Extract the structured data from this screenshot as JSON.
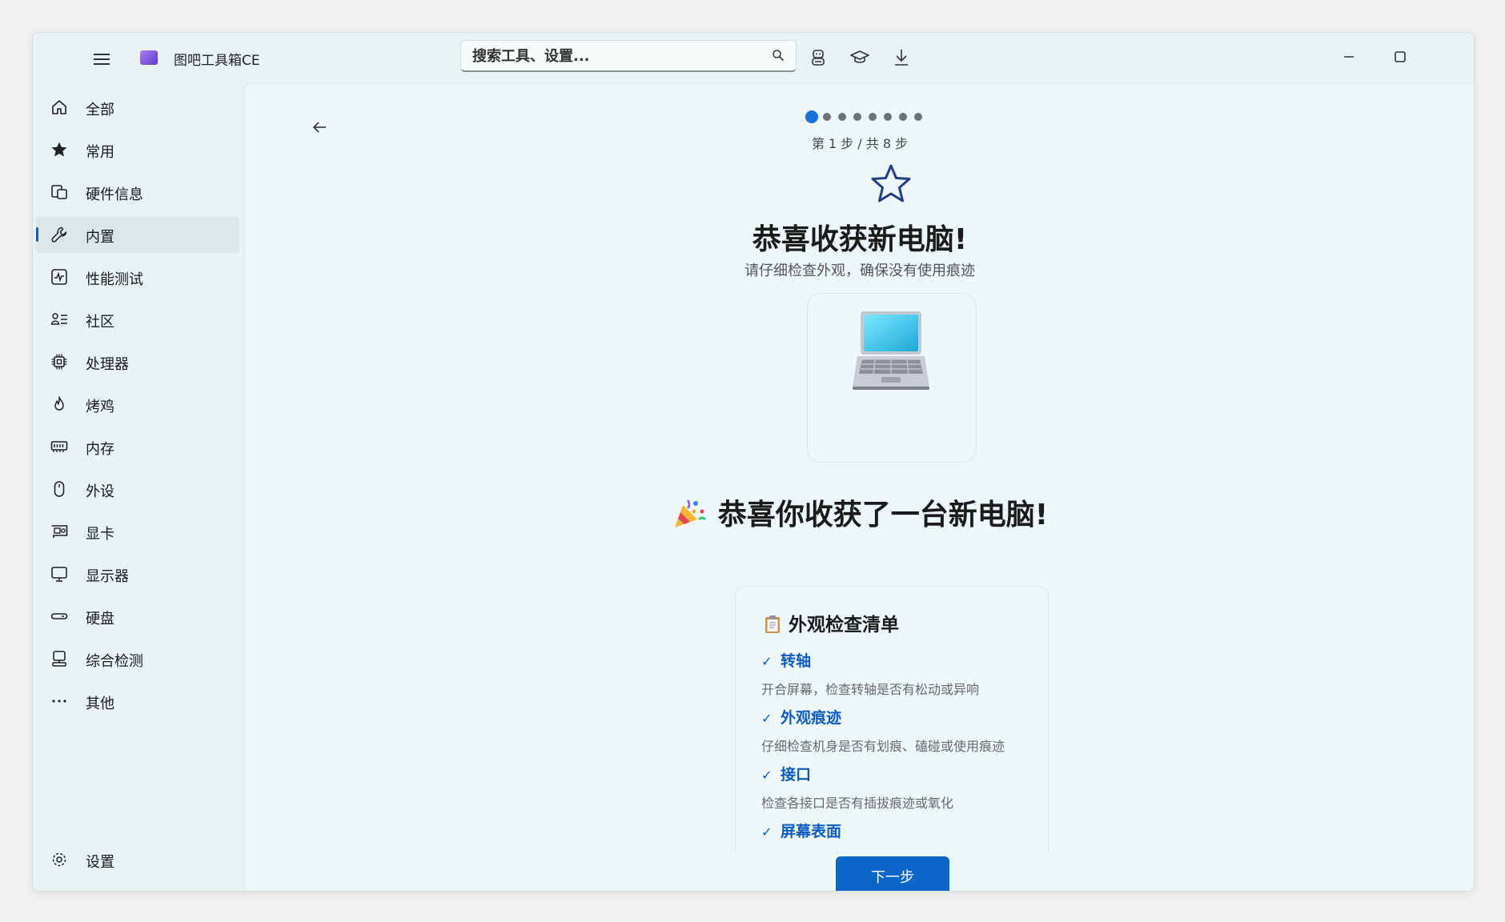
{
  "app": {
    "title": "图吧工具箱CE"
  },
  "search": {
    "placeholder": "搜索工具、设置..."
  },
  "sidebar": {
    "items": [
      {
        "label": "全部",
        "icon": "home-icon"
      },
      {
        "label": "常用",
        "icon": "star-filled-icon"
      },
      {
        "label": "硬件信息",
        "icon": "devices-icon"
      },
      {
        "label": "内置",
        "icon": "wrench-icon",
        "active": true
      },
      {
        "label": "性能测试",
        "icon": "pulse-icon"
      },
      {
        "label": "社区",
        "icon": "people-list-icon"
      },
      {
        "label": "处理器",
        "icon": "cpu-icon"
      },
      {
        "label": "烤鸡",
        "icon": "flame-icon"
      },
      {
        "label": "内存",
        "icon": "ram-icon"
      },
      {
        "label": "外设",
        "icon": "mouse-icon"
      },
      {
        "label": "显卡",
        "icon": "gpu-icon"
      },
      {
        "label": "显示器",
        "icon": "monitor-icon"
      },
      {
        "label": "硬盘",
        "icon": "disk-icon"
      },
      {
        "label": "综合检测",
        "icon": "desktop-check-icon"
      },
      {
        "label": "其他",
        "icon": "more-icon"
      }
    ],
    "settings_label": "设置"
  },
  "wizard": {
    "current_step": 1,
    "total_steps": 8,
    "step_text": "第 1 步 / 共 8 步",
    "title": "恭喜收获新电脑!",
    "subtitle": "请仔细检查外观，确保没有使用痕迹",
    "congrats": "恭喜你收获了一台新电脑!",
    "checklist": {
      "title": "外观检查清单",
      "items": [
        {
          "title": "转轴",
          "desc": "开合屏幕，检查转轴是否有松动或异响"
        },
        {
          "title": "外观痕迹",
          "desc": "仔细检查机身是否有划痕、磕碰或使用痕迹"
        },
        {
          "title": "接口",
          "desc": "检查各接口是否有插拔痕迹或氧化"
        },
        {
          "title": "屏幕表面",
          "desc": ""
        }
      ]
    },
    "next_label": "下一步"
  },
  "colors": {
    "accent": "#0b66c8",
    "link": "#0b5cc0",
    "star": "#1f3f86"
  }
}
